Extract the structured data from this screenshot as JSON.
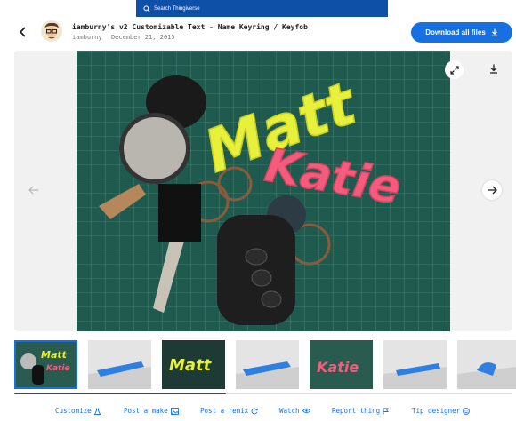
{
  "search": {
    "placeholder": "Search Thingiverse"
  },
  "thing": {
    "title": "iamburny's v2 Customizable Text - Name Keyring / Keyfob",
    "author": "iamburny",
    "date": "December 21, 2015"
  },
  "buttons": {
    "download_all": "Download all files"
  },
  "actions": [
    {
      "label": "Customize"
    },
    {
      "label": "Post a make"
    },
    {
      "label": "Post a remix"
    },
    {
      "label": "Watch"
    },
    {
      "label": "Report thing"
    },
    {
      "label": "Tip designer"
    }
  ],
  "photo_text": {
    "name1": "Matt",
    "name2": "Katie"
  },
  "colors": {
    "accent": "#1670e1",
    "search_bg": "#0e4fa8",
    "mat": "#1f5a4e",
    "yellow": "#e7f03a",
    "pink": "#f45c7e"
  }
}
